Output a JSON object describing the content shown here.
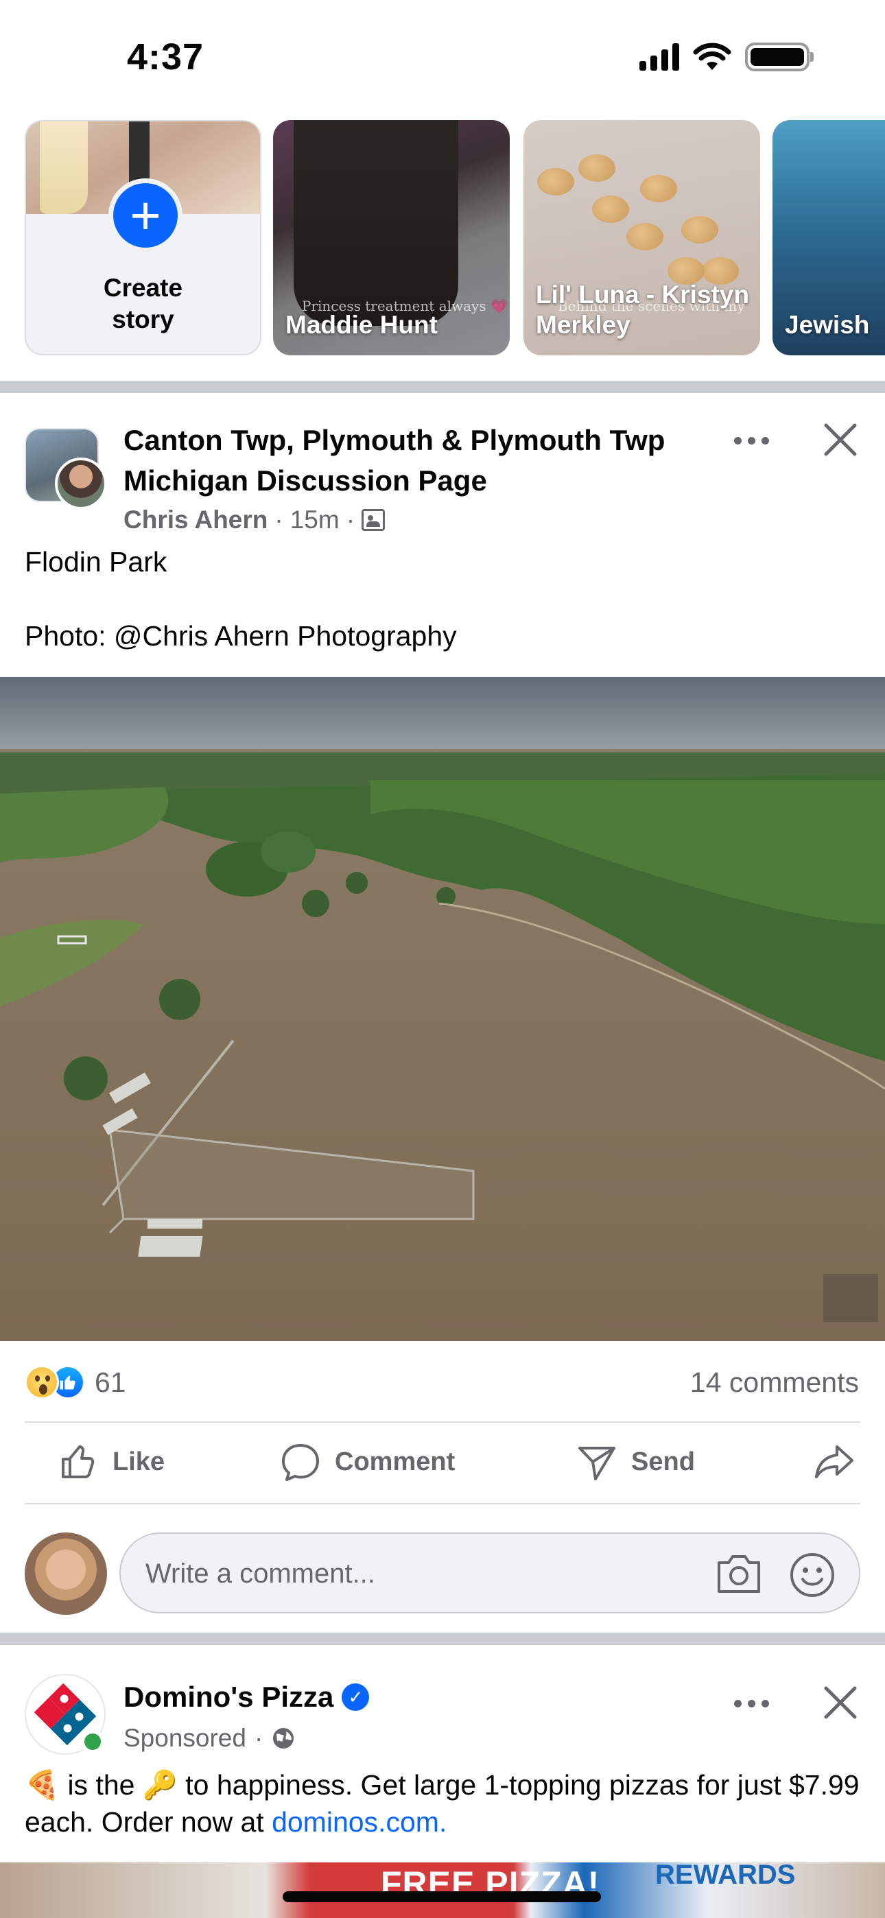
{
  "status_bar": {
    "time": "4:37"
  },
  "stories": {
    "create": {
      "label": "Create story"
    },
    "items": [
      {
        "name": "Maddie Hunt",
        "caption": "Princess treatment always 💗"
      },
      {
        "name": "Lil' Luna - Kristyn Merkley",
        "caption": "Behind the scenes with my"
      },
      {
        "name": "Jewish"
      }
    ]
  },
  "post": {
    "group_name": "Canton Twp, Plymouth & Plymouth Twp Michigan Discussion Page",
    "author": "Chris Ahern",
    "time": "15m",
    "separator": "·",
    "text_lines": [
      "Flodin Park",
      "",
      "Photo: @Chris Ahern Photography"
    ],
    "reaction_count": "61",
    "comments_count": "14 comments",
    "actions": {
      "like": "Like",
      "comment": "Comment",
      "send": "Send"
    },
    "comment_placeholder": "Write a comment..."
  },
  "ad": {
    "name": "Domino's Pizza",
    "sponsored": "Sponsored",
    "text_before": "🍕 is the 🔑 to happiness. Get large 1-topping pizzas for just $7.99 each. Order now at ",
    "link": "dominos.com.",
    "image_texts": {
      "free": "FREE PIZZA!",
      "rewards": "REWARDS"
    }
  },
  "colors": {
    "accent": "#0866ff",
    "secondary_text": "#65676b",
    "divider": "#cacdd2"
  },
  "icons": [
    "signal-icon",
    "wifi-icon",
    "battery-icon",
    "plus-icon",
    "more-icon",
    "close-icon",
    "audience-icon",
    "wow-reaction-icon",
    "like-reaction-icon",
    "like-icon",
    "comment-icon",
    "send-icon",
    "share-icon",
    "camera-icon",
    "emoji-icon",
    "verified-icon",
    "globe-icon"
  ]
}
